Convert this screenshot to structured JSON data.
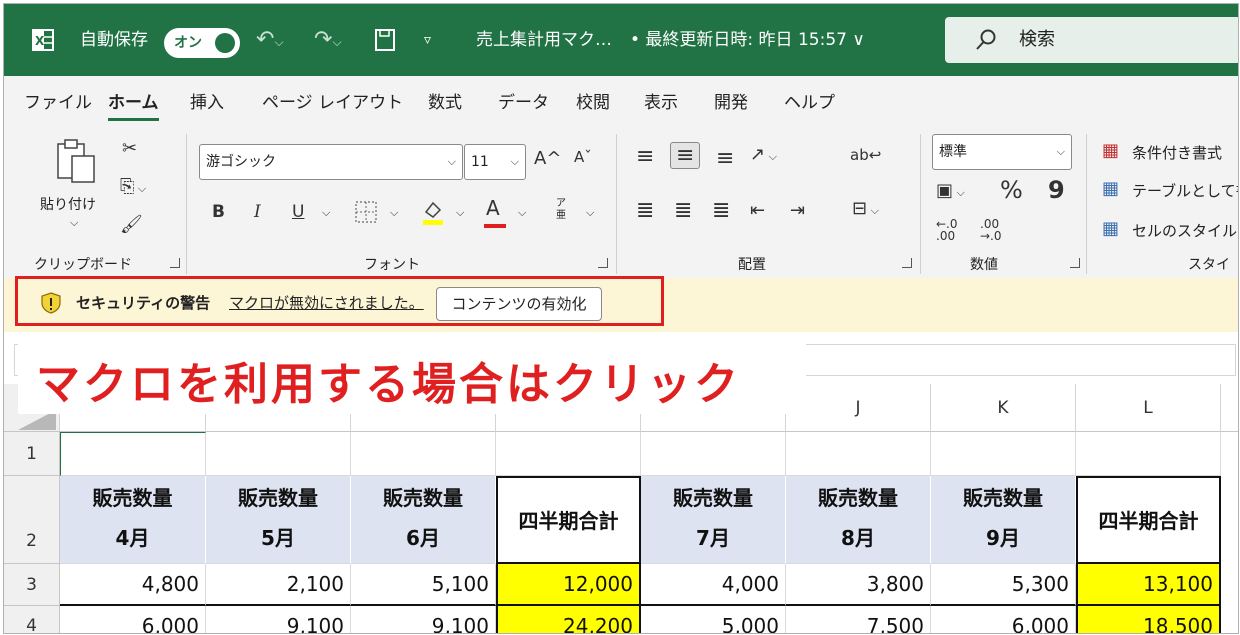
{
  "titlebar": {
    "autosave_label": "自動保存",
    "toggle_label": "オン",
    "filename": "売上集計用マク…",
    "last_modified": "• 最終更新日時: 昨日 15:57 ∨",
    "search_placeholder": "検索"
  },
  "menu": [
    "ファイル",
    "ホーム",
    "挿入",
    "ページ レイアウト",
    "数式",
    "データ",
    "校閲",
    "表示",
    "開発",
    "ヘルプ"
  ],
  "ribbon": {
    "clipboard": {
      "label": "クリップボード",
      "paste": "貼り付け"
    },
    "font": {
      "label": "フォント",
      "family": "游ゴシック",
      "size": "11",
      "bold": "B",
      "italic": "I",
      "underline": "U",
      "font_color_glyph": "A",
      "grow": "A^",
      "shrink": "Aˇ",
      "phonetic": "ア亜"
    },
    "alignment": {
      "label": "配置"
    },
    "number": {
      "label": "数値",
      "format": "標準",
      "percent": "%",
      "comma": "9"
    },
    "styles": {
      "label": "スタイル",
      "conditional": "条件付き書式",
      "table": "テーブルとして書",
      "cell_styles": "セルのスタイル"
    }
  },
  "security": {
    "title": "セキュリティの警告",
    "message": "マクロが無効にされました。",
    "button": "コンテンツの有効化"
  },
  "callout": "マクロを利用する場合はクリック",
  "columns": [
    "J",
    "K",
    "L"
  ],
  "rows": [
    "1",
    "2",
    "3",
    "4"
  ],
  "table": {
    "headers": [
      {
        "line1": "販売数量",
        "line2": "4月"
      },
      {
        "line1": "販売数量",
        "line2": "5月"
      },
      {
        "line1": "販売数量",
        "line2": "6月"
      },
      {
        "line1": "四半期合計",
        "line2": ""
      },
      {
        "line1": "販売数量",
        "line2": "7月"
      },
      {
        "line1": "販売数量",
        "line2": "8月"
      },
      {
        "line1": "販売数量",
        "line2": "9月"
      },
      {
        "line1": "四半期合計",
        "line2": ""
      }
    ],
    "row3": [
      "4,800",
      "2,100",
      "5,100",
      "12,000",
      "4,000",
      "3,800",
      "5,300",
      "13,100"
    ],
    "row4": [
      "6,000",
      "9,100",
      "9,100",
      "24,200",
      "5,000",
      "7,500",
      "6,000",
      "18,500"
    ]
  },
  "colors": {
    "excel_green": "#217346",
    "quarter_fill": "#ffff00",
    "header_fill": "#dde3f1",
    "alert_red": "#e02020"
  }
}
